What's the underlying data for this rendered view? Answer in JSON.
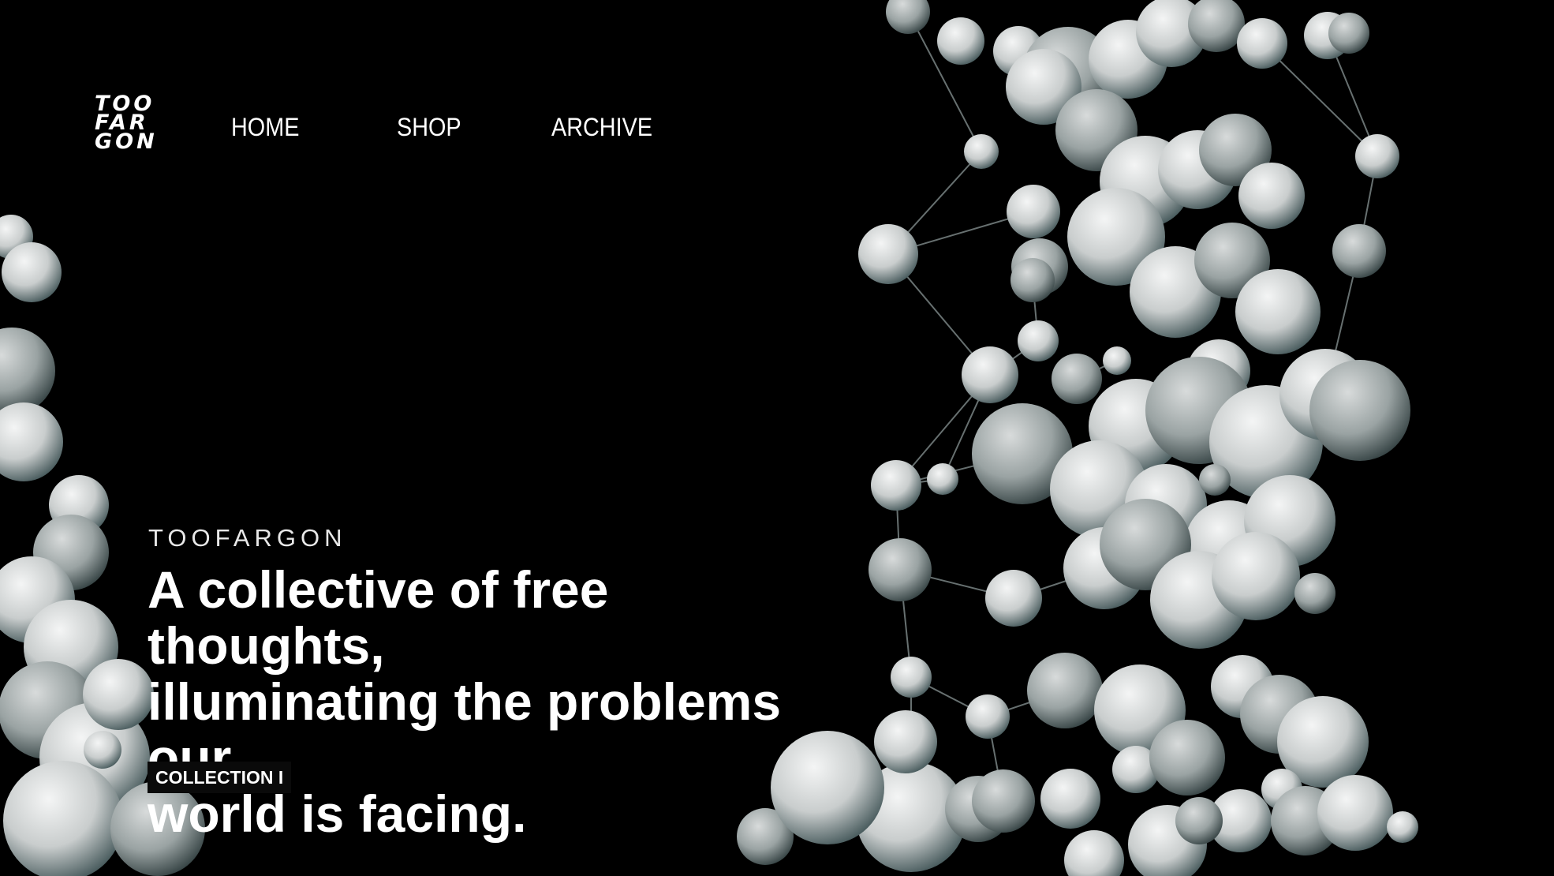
{
  "brand": {
    "logo_lines": [
      "TOO",
      "FAR",
      "GON"
    ]
  },
  "nav": {
    "home": "HOME",
    "shop": "SHOP",
    "archive": "ARCHIVE"
  },
  "hero": {
    "eyebrow": "TOOFARGON",
    "headline_lines": [
      "A collective of free thoughts,",
      "illuminating the problems our",
      "world is facing."
    ],
    "cta": "COLLECTION I"
  },
  "colors": {
    "background": "#000000",
    "sphere": "#d9dcdc",
    "sphere_shadow": "#4f6366",
    "text": "#ffffff"
  }
}
